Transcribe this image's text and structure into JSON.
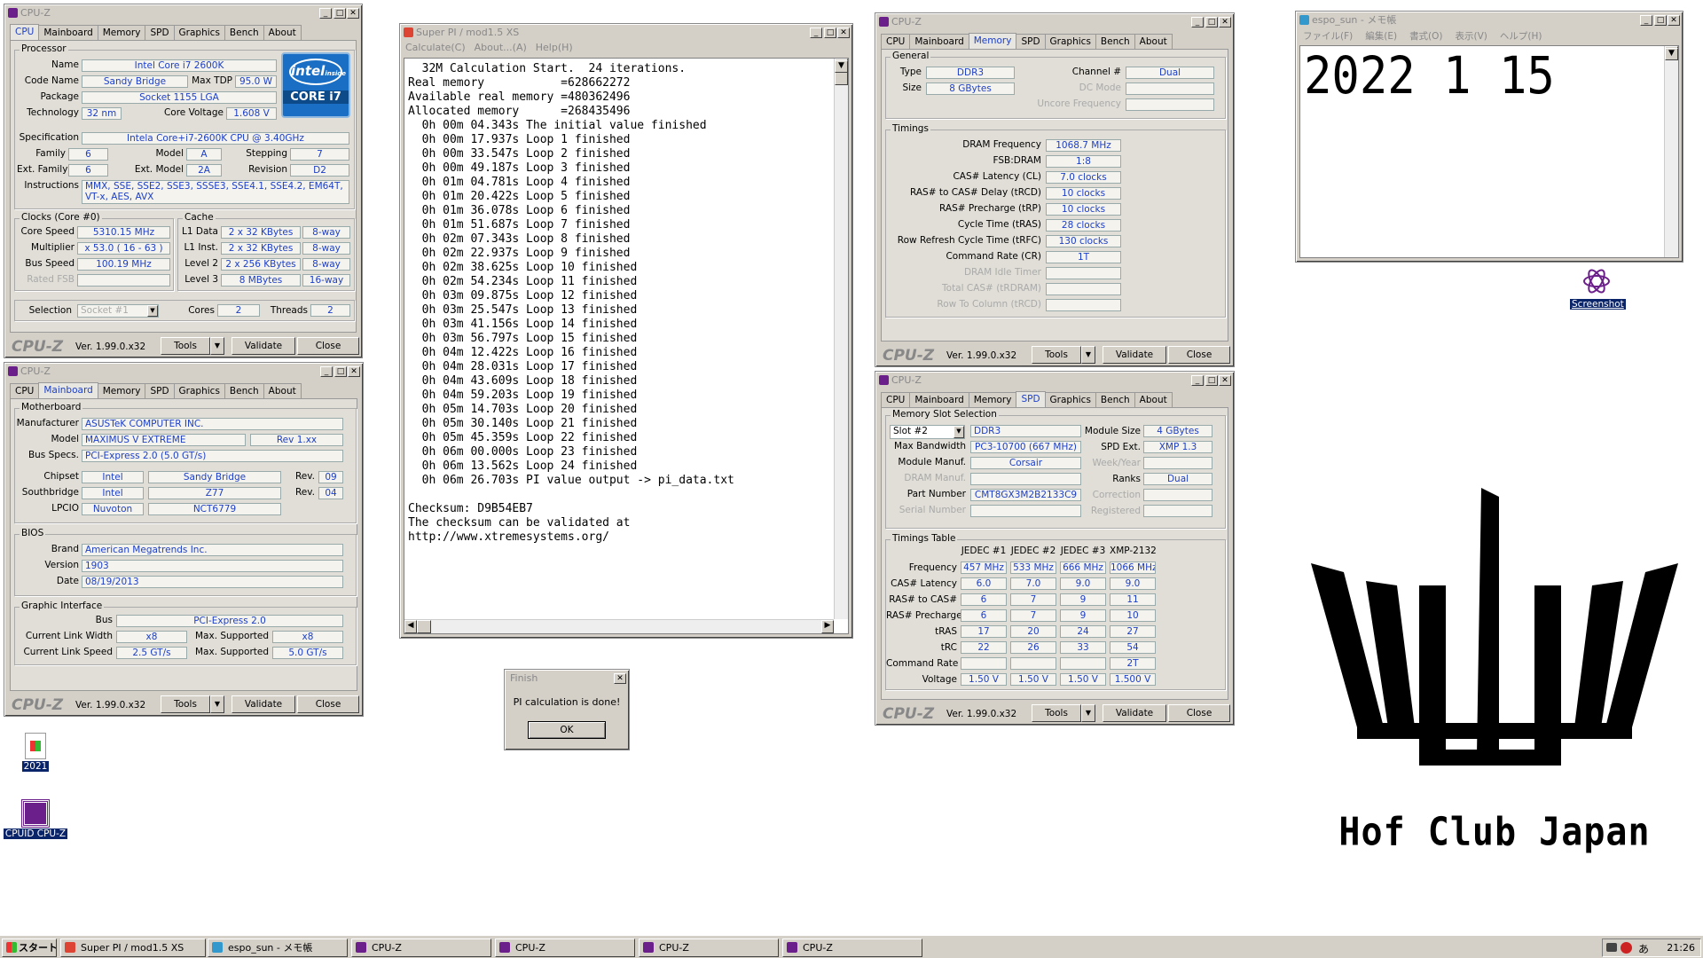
{
  "cpuz1": {
    "title": "CPU-Z",
    "tabs": [
      "CPU",
      "Mainboard",
      "Memory",
      "SPD",
      "Graphics",
      "Bench",
      "About"
    ],
    "processor": "Processor",
    "name_l": "Name",
    "name": "Intel Core i7 2600K",
    "code_l": "Code Name",
    "code": "Sandy Bridge",
    "tdp_l": "Max TDP",
    "tdp": "95.0 W",
    "pkg_l": "Package",
    "pkg": "Socket 1155 LGA",
    "tech_l": "Technology",
    "tech": "32 nm",
    "volt_l": "Core Voltage",
    "volt": "1.608 V",
    "spec_l": "Specification",
    "spec": "Intela Core+i7-2600K CPU @ 3.40GHz",
    "fam_l": "Family",
    "fam": "6",
    "model_l": "Model",
    "model": "A",
    "step_l": "Stepping",
    "step": "7",
    "efam_l": "Ext. Family",
    "efam": "6",
    "emod_l": "Ext. Model",
    "emod": "2A",
    "rev_l": "Revision",
    "rev": "D2",
    "inst_l": "Instructions",
    "inst": "MMX, SSE, SSE2, SSE3, SSSE3, SSE4.1, SSE4.2, EM64T, VT-x, AES, AVX",
    "clocks": "Clocks (Core #0)",
    "cs_l": "Core Speed",
    "cs": "5310.15 MHz",
    "mul_l": "Multiplier",
    "mul": "x 53.0 ( 16 - 63 )",
    "bus_l": "Bus Speed",
    "bus": "100.19 MHz",
    "fsb_l": "Rated FSB",
    "cache": "Cache",
    "l1d_l": "L1 Data",
    "l1d": "2 x 32 KBytes",
    "l1d_w": "8-way",
    "l1i_l": "L1 Inst.",
    "l1i": "2 x 32 KBytes",
    "l1i_w": "8-way",
    "l2_l": "Level 2",
    "l2": "2 x 256 KBytes",
    "l2_w": "8-way",
    "l3_l": "Level 3",
    "l3": "8 MBytes",
    "l3_w": "16-way",
    "sel_l": "Selection",
    "sel": "Socket #1",
    "cores_l": "Cores",
    "cores": "2",
    "thr_l": "Threads",
    "thr": "2",
    "intel1": "intel",
    "intel2": "inside",
    "intel3": "CORE i7"
  },
  "common": {
    "logo": "CPU-Z",
    "ver": "Ver. 1.99.0.x32",
    "tools": "Tools",
    "validate": "Validate",
    "close": "Close"
  },
  "cpuz2": {
    "title": "CPU-Z",
    "mb": "Motherboard",
    "man_l": "Manufacturer",
    "man": "ASUSTeK COMPUTER INC.",
    "model_l": "Model",
    "model": "MAXIMUS V EXTREME",
    "mrev": "Rev 1.xx",
    "bus_l": "Bus Specs.",
    "bus": "PCI-Express 2.0 (5.0 GT/s)",
    "chip_l": "Chipset",
    "chip_v": "Intel",
    "chip_n": "Sandy Bridge",
    "rev_l": "Rev.",
    "chip_r": "09",
    "sb_l": "Southbridge",
    "sb_v": "Intel",
    "sb_n": "Z77",
    "sb_r": "04",
    "lpc_l": "LPCIO",
    "lpc_v": "Nuvoton",
    "lpc_n": "NCT6779",
    "bios": "BIOS",
    "brand_l": "Brand",
    "brand": "American Megatrends Inc.",
    "bver_l": "Version",
    "bver": "1903",
    "date_l": "Date",
    "date": "08/19/2013",
    "gi": "Graphic Interface",
    "gbus_l": "Bus",
    "gbus": "PCI-Express 2.0",
    "clw_l": "Current Link Width",
    "clw": "x8",
    "msw_l": "Max. Supported",
    "msw": "x8",
    "cls_l": "Current Link Speed",
    "cls": "2.5 GT/s",
    "mss_l": "Max. Supported",
    "mss": "5.0 GT/s"
  },
  "superpi": {
    "title": "Super PI / mod1.5 XS",
    "menu": [
      "Calculate(C)",
      "About...(A)",
      "Help(H)"
    ],
    "lines": [
      "  32M Calculation Start.  24 iterations.",
      "Real memory           =628662272",
      "Available real memory =480362496",
      "Allocated memory      =268435496",
      "  0h 00m 04.343s The initial value finished",
      "  0h 00m 17.937s Loop 1 finished",
      "  0h 00m 33.547s Loop 2 finished",
      "  0h 00m 49.187s Loop 3 finished",
      "  0h 01m 04.781s Loop 4 finished",
      "  0h 01m 20.422s Loop 5 finished",
      "  0h 01m 36.078s Loop 6 finished",
      "  0h 01m 51.687s Loop 7 finished",
      "  0h 02m 07.343s Loop 8 finished",
      "  0h 02m 22.937s Loop 9 finished",
      "  0h 02m 38.625s Loop 10 finished",
      "  0h 02m 54.234s Loop 11 finished",
      "  0h 03m 09.875s Loop 12 finished",
      "  0h 03m 25.547s Loop 13 finished",
      "  0h 03m 41.156s Loop 14 finished",
      "  0h 03m 56.797s Loop 15 finished",
      "  0h 04m 12.422s Loop 16 finished",
      "  0h 04m 28.031s Loop 17 finished",
      "  0h 04m 43.609s Loop 18 finished",
      "  0h 04m 59.203s Loop 19 finished",
      "  0h 05m 14.703s Loop 20 finished",
      "  0h 05m 30.140s Loop 21 finished",
      "  0h 05m 45.359s Loop 22 finished",
      "  0h 06m 00.000s Loop 23 finished",
      "  0h 06m 13.562s Loop 24 finished",
      "  0h 06m 26.703s PI value output -> pi_data.txt",
      "",
      "Checksum: D9B54EB7",
      "The checksum can be validated at",
      "http://www.xtremesystems.org/"
    ]
  },
  "finish": {
    "title": "Finish",
    "msg": "PI calculation is done!",
    "ok": "OK"
  },
  "cpuz3": {
    "title": "CPU-Z",
    "general": "General",
    "type_l": "Type",
    "type": "DDR3",
    "ch_l": "Channel #",
    "ch": "Dual",
    "size_l": "Size",
    "size": "8 GBytes",
    "dc_l": "DC Mode",
    "unc_l": "Uncore Frequency",
    "timings": "Timings",
    "dram_l": "DRAM Frequency",
    "dram": "1068.7 MHz",
    "fsb_l": "FSB:DRAM",
    "fsb": "1:8",
    "cl_l": "CAS# Latency (CL)",
    "cl": "7.0 clocks",
    "rcd_l": "RAS# to CAS# Delay (tRCD)",
    "rcd": "10 clocks",
    "rp_l": "RAS# Precharge (tRP)",
    "rp": "10 clocks",
    "ras_l": "Cycle Time (tRAS)",
    "ras": "28 clocks",
    "rfc_l": "Row Refresh Cycle Time (tRFC)",
    "rfc": "130 clocks",
    "cr_l": "Command Rate (CR)",
    "cr": "1T",
    "idle_l": "DRAM Idle Timer",
    "tot_l": "Total CAS# (tRDRAM)",
    "rtc_l": "Row To Column (tRCD)"
  },
  "cpuz4": {
    "title": "CPU-Z",
    "mss": "Memory Slot Selection",
    "slot": "Slot #2",
    "ddr": "DDR3",
    "msize_l": "Module Size",
    "msize": "4 GBytes",
    "mbw_l": "Max Bandwidth",
    "mbw": "PC3-10700 (667 MHz)",
    "spdx_l": "SPD Ext.",
    "spdx": "XMP 1.3",
    "mman_l": "Module Manuf.",
    "mman": "Corsair",
    "wy_l": "Week/Year",
    "dman_l": "DRAM Manuf.",
    "ranks_l": "Ranks",
    "ranks": "Dual",
    "pn_l": "Part Number",
    "pn": "CMT8GX3M2B2133C9",
    "corr_l": "Correction",
    "sn_l": "Serial Number",
    "reg_l": "Registered",
    "tt": "Timings Table",
    "cols": [
      "JEDEC #1",
      "JEDEC #2",
      "JEDEC #3",
      "XMP-2132"
    ],
    "rows": [
      {
        "l": "Frequency",
        "v": [
          "457 MHz",
          "533 MHz",
          "666 MHz",
          "1066 MHz"
        ]
      },
      {
        "l": "CAS# Latency",
        "v": [
          "6.0",
          "7.0",
          "9.0",
          "9.0"
        ]
      },
      {
        "l": "RAS# to CAS#",
        "v": [
          "6",
          "7",
          "9",
          "11"
        ]
      },
      {
        "l": "RAS# Precharge",
        "v": [
          "6",
          "7",
          "9",
          "10"
        ]
      },
      {
        "l": "tRAS",
        "v": [
          "17",
          "20",
          "24",
          "27"
        ]
      },
      {
        "l": "tRC",
        "v": [
          "22",
          "26",
          "33",
          "54"
        ]
      },
      {
        "l": "Command Rate",
        "v": [
          "",
          "",
          "",
          "2T"
        ]
      },
      {
        "l": "Voltage",
        "v": [
          "1.50 V",
          "1.50 V",
          "1.50 V",
          "1.500 V"
        ]
      }
    ]
  },
  "notepad": {
    "title": "espo_sun - メモ帳",
    "menu": [
      "ファイル(F)",
      "編集(E)",
      "書式(O)",
      "表示(V)",
      "ヘルプ(H)"
    ],
    "text": "2022 1 15"
  },
  "desktop": {
    "screenshot": "Screenshot",
    "icon2021": "2021",
    "cpuzicon": "CPUID CPU-Z",
    "hof": "Hof Club Japan"
  },
  "taskbar": {
    "start": "スタート",
    "items": [
      "Super PI / mod1.5 XS",
      "espo_sun - メモ帳",
      "CPU-Z",
      "CPU-Z",
      "CPU-Z",
      "CPU-Z"
    ],
    "time": "21:26"
  }
}
